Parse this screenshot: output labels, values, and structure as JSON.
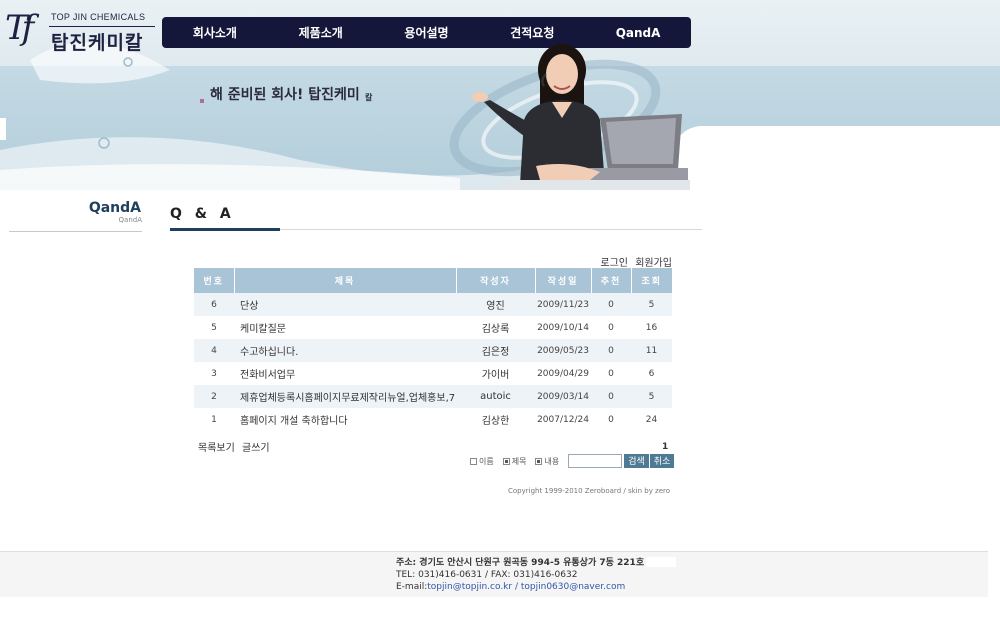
{
  "brand": {
    "logo_mark": "Tf",
    "name_en": "TOP JIN CHEMICALS",
    "name_kr": "탑진케미칼"
  },
  "nav": {
    "items": [
      {
        "label": "회사소개"
      },
      {
        "label": "제품소개"
      },
      {
        "label": "용어설명"
      },
      {
        "label": "견적요청"
      },
      {
        "label": "QandA"
      }
    ]
  },
  "slogan": {
    "main": "해 준비된 회사! 탑진케미",
    "tail": "칼"
  },
  "sidebar": {
    "title": "QandA",
    "subtitle": "QandA"
  },
  "page": {
    "heading": "Q & A"
  },
  "board": {
    "top_links": {
      "login": "로그인",
      "join": "회원가입"
    },
    "columns": [
      "번호",
      "제목",
      "작성자",
      "작성일",
      "추천",
      "조회"
    ],
    "rows": [
      {
        "no": "6",
        "title": "단상",
        "author": "영진",
        "date": "2009/11/23",
        "vote": "0",
        "hit": "5"
      },
      {
        "no": "5",
        "title": "케미칼질문",
        "author": "김상록",
        "date": "2009/10/14",
        "vote": "0",
        "hit": "16"
      },
      {
        "no": "4",
        "title": "수고하십니다.",
        "author": "김은정",
        "date": "2009/05/23",
        "vote": "0",
        "hit": "11"
      },
      {
        "no": "3",
        "title": "전화비서업무",
        "author": "가이버",
        "date": "2009/04/29",
        "vote": "0",
        "hit": "6"
      },
      {
        "no": "2",
        "title": "제휴업체등록시홈페이지무료제작리뉴얼,업체홍보,7",
        "author": "autoic",
        "date": "2009/03/14",
        "vote": "0",
        "hit": "5"
      },
      {
        "no": "1",
        "title": "홈페이지 개설 축하합니다",
        "author": "김상한",
        "date": "2007/12/24",
        "vote": "0",
        "hit": "24"
      }
    ],
    "bottom_links": {
      "list": "목록보기",
      "write": "글쓰기"
    },
    "page_number": "1",
    "search": {
      "options": [
        {
          "label": "이름",
          "checked": false
        },
        {
          "label": "제목",
          "checked": true
        },
        {
          "label": "내용",
          "checked": true
        }
      ],
      "input_value": "",
      "search_button": "검색",
      "cancel_button": "취소"
    },
    "copyright": "Copyright 1999-2010 Zeroboard / skin by zero"
  },
  "footer": {
    "address": "주소: 경기도 안산시 단원구 원곡동 994-5 유통상가 7동 221호",
    "tel_fax": "TEL: 031)416-0631 / FAX: 031)416-0632",
    "email_label": "E-mail:",
    "email_1": "topjin@topjin.co.kr",
    "email_sep": " / ",
    "email_2": "topjin0630@naver.com"
  },
  "colors": {
    "nav_bg": "#14173a",
    "header_band": "#b9d3df",
    "table_header": "#a9c4d6",
    "accent": "#1f3f5e"
  },
  "icons": {
    "logo": "tj-monogram-icon",
    "checkbox": "checkbox-icon"
  }
}
